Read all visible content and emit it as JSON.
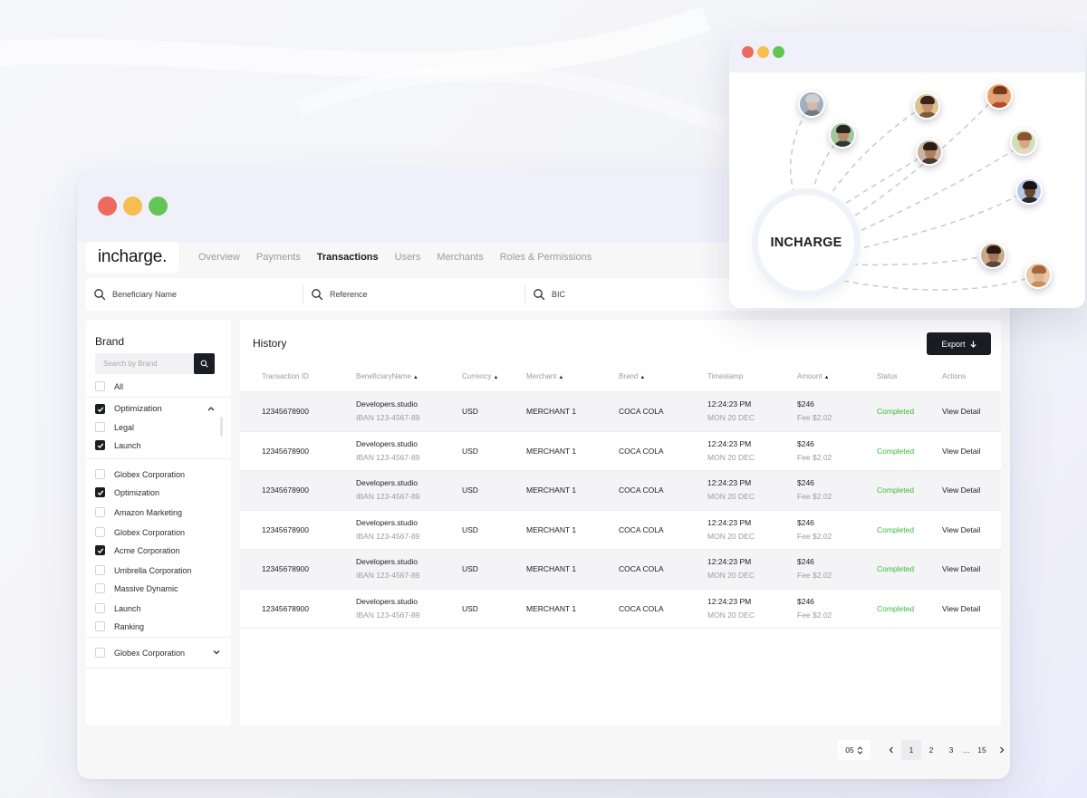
{
  "main_window": {
    "logo": "incharge.",
    "nav": {
      "tabs": [
        "Overview",
        "Payments",
        "Transactions",
        "Users",
        "Merchants",
        "Roles & Permissions"
      ],
      "active": "Transactions"
    },
    "search": {
      "beneficiary": "Beneficiary Name",
      "reference": "Reference",
      "bic": "BIC"
    },
    "sidebar": {
      "title": "Brand",
      "search_placeholder": "Search by Brand",
      "items": [
        {
          "label": "All",
          "checked": false
        },
        {
          "label": "Optimization",
          "checked": true,
          "expanded": true
        },
        {
          "label": "Legal",
          "checked": false
        },
        {
          "label": "Launch",
          "checked": true
        },
        {
          "label": "Globex Corporation",
          "checked": false
        },
        {
          "label": "Optimization",
          "checked": true
        },
        {
          "label": "Amazon Marketing",
          "checked": false
        },
        {
          "label": "Globex Corporation",
          "checked": false
        },
        {
          "label": "Acme Corporation",
          "checked": true
        },
        {
          "label": "Umbrella Corporation",
          "checked": false
        },
        {
          "label": "Massive Dynamic",
          "checked": false
        },
        {
          "label": "Launch",
          "checked": false
        },
        {
          "label": "Ranking",
          "checked": false
        },
        {
          "label": "Globex Corporation",
          "checked": false,
          "collapsed": true
        }
      ]
    },
    "history": {
      "title": "History",
      "export_label": "Export",
      "columns": [
        "Transaction ID",
        "BeneficiaryName",
        "Currency",
        "Merchant",
        "Brand",
        "Timestamp",
        "Amount",
        "Status",
        "Actions"
      ],
      "rows": [
        {
          "id": "12345678900",
          "name": "Developers.studio",
          "iban": "IBAN 123-4567-89",
          "currency": "USD",
          "merchant": "MERCHANT 1",
          "brand": "COCA COLA",
          "time": "12:24:23 PM",
          "date": "MON 20 DEC",
          "amount": "$246",
          "fee": "Fee $2.02",
          "status": "Completed",
          "action": "View Detail"
        },
        {
          "id": "12345678900",
          "name": "Developers.studio",
          "iban": "IBAN 123-4567-89",
          "currency": "USD",
          "merchant": "MERCHANT 1",
          "brand": "COCA COLA",
          "time": "12:24:23 PM",
          "date": "MON 20 DEC",
          "amount": "$246",
          "fee": "Fee $2.02",
          "status": "Completed",
          "action": "View Detail"
        },
        {
          "id": "12345678900",
          "name": "Developers.studio",
          "iban": "IBAN 123-4567-89",
          "currency": "USD",
          "merchant": "MERCHANT 1",
          "brand": "COCA COLA",
          "time": "12:24:23 PM",
          "date": "MON 20 DEC",
          "amount": "$246",
          "fee": "Fee $2.02",
          "status": "Completed",
          "action": "View Detail"
        },
        {
          "id": "12345678900",
          "name": "Developers.studio",
          "iban": "IBAN 123-4567-89",
          "currency": "USD",
          "merchant": "MERCHANT 1",
          "brand": "COCA COLA",
          "time": "12:24:23 PM",
          "date": "MON 20 DEC",
          "amount": "$246",
          "fee": "Fee $2.02",
          "status": "Completed",
          "action": "View Detail"
        },
        {
          "id": "12345678900",
          "name": "Developers.studio",
          "iban": "IBAN 123-4567-89",
          "currency": "USD",
          "merchant": "MERCHANT 1",
          "brand": "COCA COLA",
          "time": "12:24:23 PM",
          "date": "MON 20 DEC",
          "amount": "$246",
          "fee": "Fee $2.02",
          "status": "Completed",
          "action": "View Detail"
        },
        {
          "id": "12345678900",
          "name": "Developers.studio",
          "iban": "IBAN 123-4567-89",
          "currency": "USD",
          "merchant": "MERCHANT 1",
          "brand": "COCA COLA",
          "time": "12:24:23 PM",
          "date": "MON 20 DEC",
          "amount": "$246",
          "fee": "Fee $2.02",
          "status": "Completed",
          "action": "View Detail"
        }
      ]
    },
    "pagination": {
      "per_page": "05",
      "pages": [
        "1",
        "2",
        "3"
      ],
      "ellipsis": "...",
      "last": "15",
      "current": "1"
    }
  },
  "network_window": {
    "hub_label": "INCHARGE",
    "avatar_count": 10
  },
  "colors": {
    "accent_dark": "#1c1d22",
    "status_green": "#3eba3b",
    "window_red": "#ee6a5f",
    "window_yellow": "#f5be4f",
    "window_green": "#62c655",
    "titlebar": "#f0f0fb"
  },
  "icons": [
    "search-icon",
    "arrow-down-icon",
    "chevron-up-icon",
    "chevron-down-icon",
    "sort-icon",
    "chevron-left-icon",
    "chevron-right-icon",
    "check-icon"
  ]
}
